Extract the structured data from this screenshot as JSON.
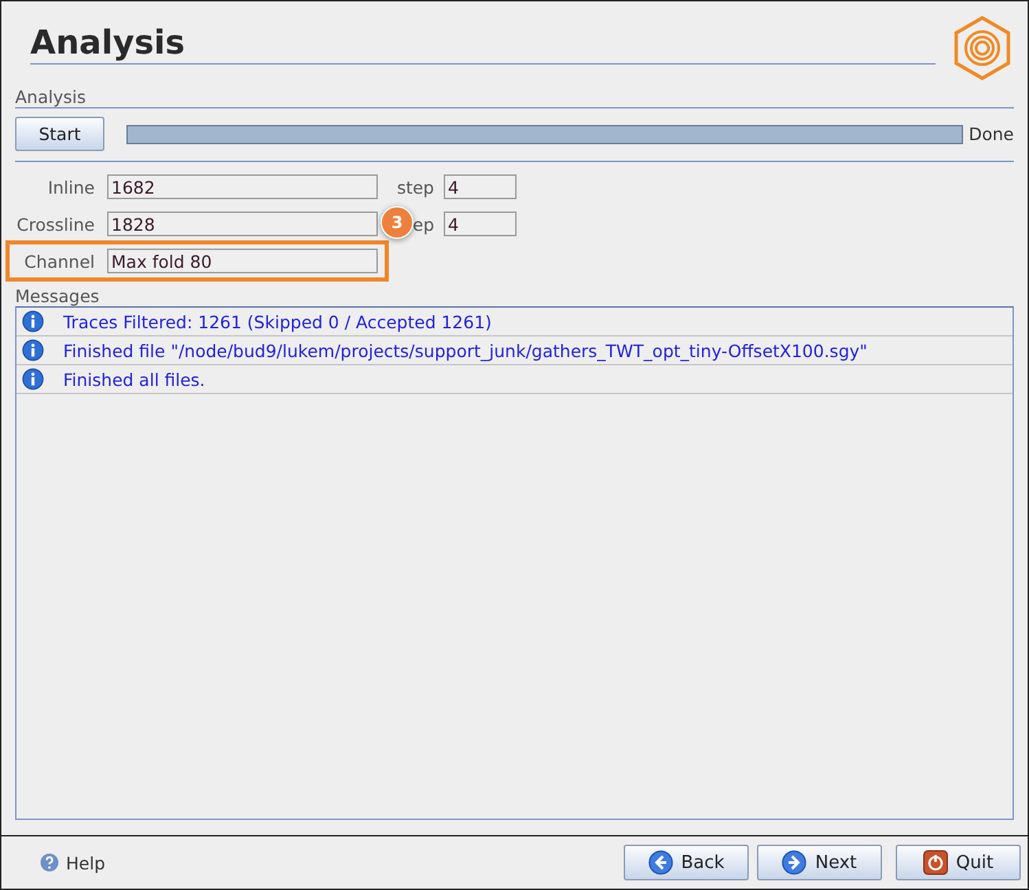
{
  "header": {
    "title": "Analysis"
  },
  "analysis": {
    "section": "Analysis",
    "start_button": "Start",
    "progress": {
      "level": 1.0
    },
    "status": "Done"
  },
  "fields": [
    {
      "label": "Inline",
      "value": "1682",
      "step_label": "step",
      "step_value": "4"
    },
    {
      "label": "Crossline",
      "value": "1828",
      "step_label": "ep",
      "step_value": "4"
    },
    {
      "label": "Channel",
      "value": "Max fold 80",
      "highlighted": true
    }
  ],
  "callout": {
    "number": "3"
  },
  "messages": {
    "section": "Messages",
    "items": [
      {
        "kind": "info",
        "text": "Traces Filtered: 1261 (Skipped 0 / Accepted 1261)"
      },
      {
        "kind": "info",
        "text": "Finished file \"/node/bud9/lukem/projects/support_junk/gathers_TWT_opt_tiny-OffsetX100.sgy\""
      },
      {
        "kind": "info",
        "text": "Finished all files."
      }
    ]
  },
  "footer": {
    "help": "Help",
    "buttons": [
      {
        "kind": "back",
        "label": "Back"
      },
      {
        "kind": "next",
        "label": "Next"
      },
      {
        "kind": "quit",
        "label": "Quit"
      }
    ]
  }
}
